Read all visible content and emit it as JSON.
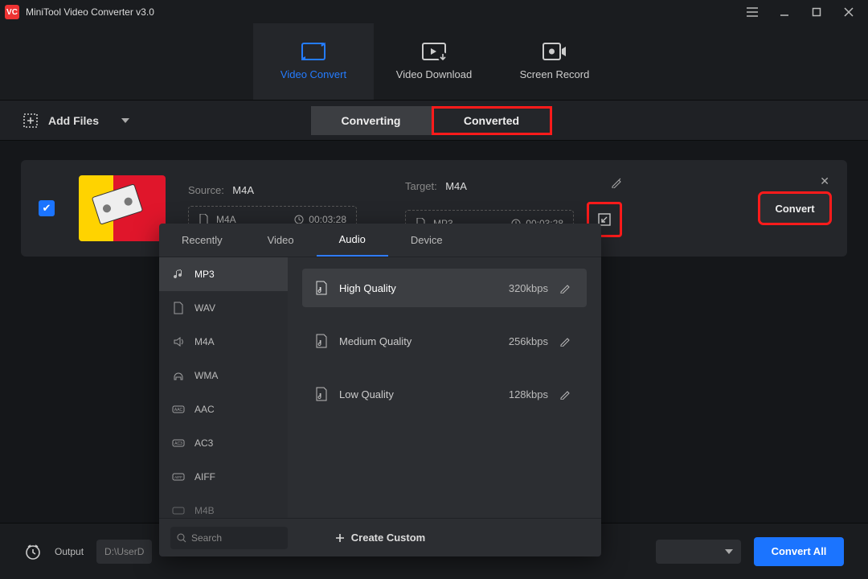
{
  "app": {
    "name": "VC",
    "title": "MiniTool Video Converter v3.0"
  },
  "nav": {
    "convert": "Video Convert",
    "download": "Video Download",
    "record": "Screen Record"
  },
  "toolbar": {
    "add_files": "Add Files",
    "converting": "Converting",
    "converted": "Converted"
  },
  "file": {
    "source_label": "Source:",
    "source_format": "M4A",
    "source_container": "M4A",
    "source_duration": "00:03:28",
    "target_label": "Target:",
    "target_format": "M4A",
    "target_container": "MP3",
    "target_duration": "00:03:28",
    "convert": "Convert"
  },
  "picker": {
    "tabs": {
      "recently": "Recently",
      "video": "Video",
      "audio": "Audio",
      "device": "Device"
    },
    "formats": [
      "MP3",
      "WAV",
      "M4A",
      "WMA",
      "AAC",
      "AC3",
      "AIFF",
      "M4B"
    ],
    "quality": [
      {
        "label": "High Quality",
        "rate": "320kbps"
      },
      {
        "label": "Medium Quality",
        "rate": "256kbps"
      },
      {
        "label": "Low Quality",
        "rate": "128kbps"
      }
    ],
    "search_placeholder": "Search",
    "create_custom": "Create Custom"
  },
  "bottom": {
    "output_label": "Output",
    "output_path": "D:\\UserD",
    "convert_all": "Convert All"
  }
}
